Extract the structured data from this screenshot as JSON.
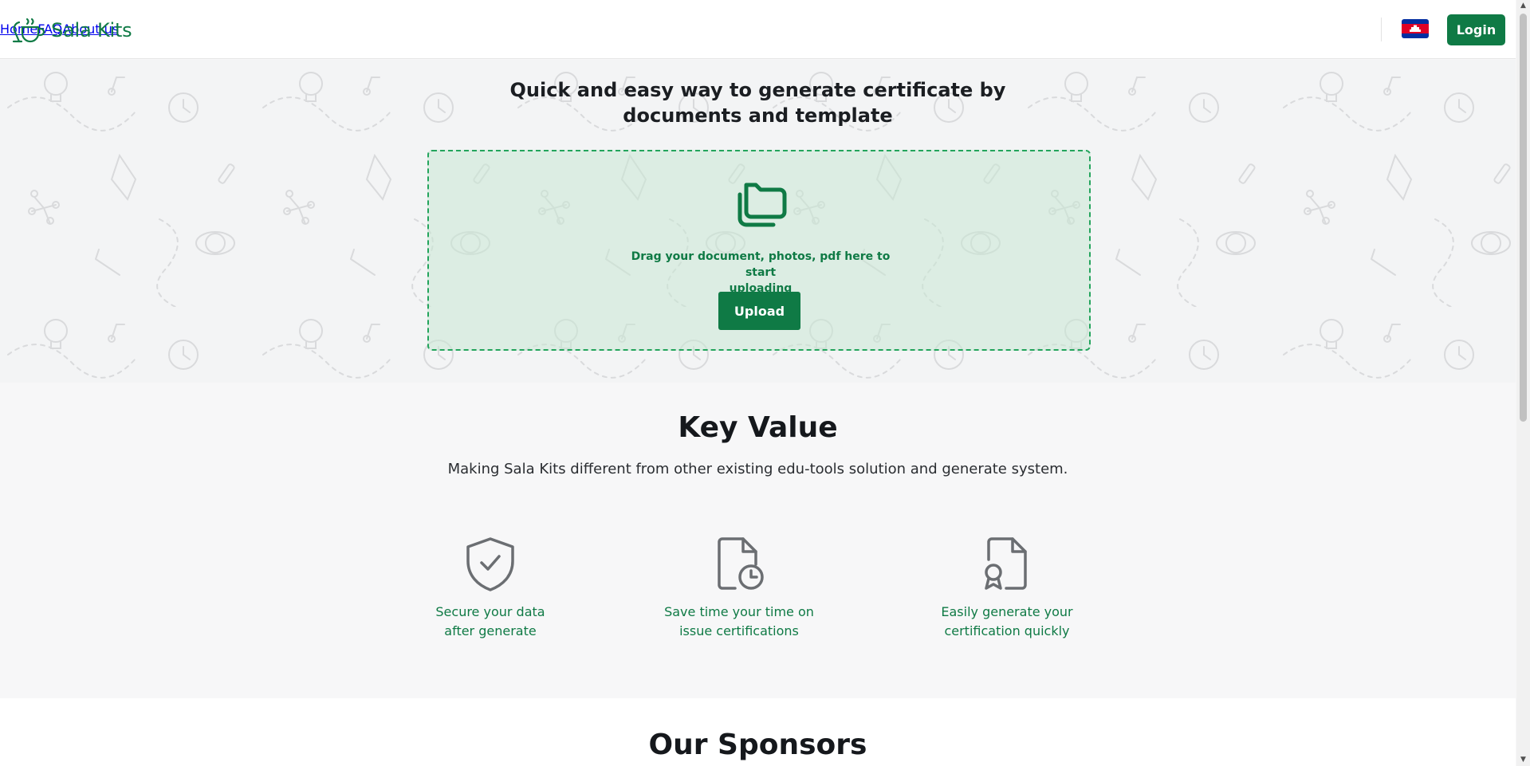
{
  "header": {
    "brand": "Sala Kits",
    "nav": [
      "Home",
      "FAQ",
      "About us"
    ],
    "login_label": "Login",
    "flag_icon": "cambodia-flag-icon"
  },
  "hero": {
    "title_line1": "Quick and easy way to generate certificate by",
    "title_line2": "documents and template",
    "drop_line1": "Drag your document, photos, pdf here to start",
    "drop_line2": "uploading",
    "upload_label": "Upload"
  },
  "key_value": {
    "title": "Key Value",
    "subtitle": "Making Sala Kits different from other existing edu-tools solution and generate system.",
    "features": [
      {
        "icon": "shield-check-icon",
        "line1": "Secure your data",
        "line2": "after generate"
      },
      {
        "icon": "file-clock-icon",
        "line1": "Save time your time on",
        "line2": "issue certifications"
      },
      {
        "icon": "file-certificate-icon",
        "line1": "Easily generate your",
        "line2": "certification quickly"
      }
    ]
  },
  "sponsors": {
    "title": "Our Sponsors"
  },
  "colors": {
    "brand": "#0f7a45",
    "dropzone_border": "#23a45c",
    "background": "#f7f7f8"
  }
}
